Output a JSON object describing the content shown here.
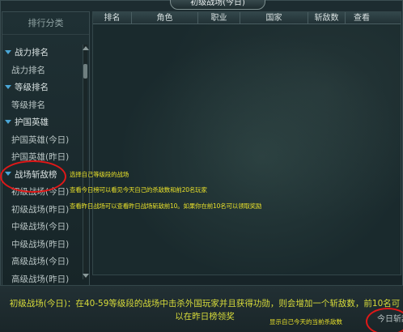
{
  "window": {
    "title": "初级战场(今日)"
  },
  "sidebar": {
    "header": "排行分类",
    "items": [
      {
        "label": "战力排名",
        "type": "category"
      },
      {
        "label": "战力排名",
        "type": "sub"
      },
      {
        "label": "等级排名",
        "type": "category"
      },
      {
        "label": "等级排名",
        "type": "sub"
      },
      {
        "label": "护国英雄",
        "type": "category"
      },
      {
        "label": "护国英雄(今日)",
        "type": "sub"
      },
      {
        "label": "护国英雄(昨日)",
        "type": "sub"
      },
      {
        "label": "战场斩敌榜",
        "type": "category"
      },
      {
        "label": "初级战场(今日)",
        "type": "sub"
      },
      {
        "label": "初级战场(昨日)",
        "type": "sub"
      },
      {
        "label": "中级战场(今日)",
        "type": "sub"
      },
      {
        "label": "中级战场(昨日)",
        "type": "sub"
      },
      {
        "label": "高级战场(今日)",
        "type": "sub"
      },
      {
        "label": "高级战场(昨日)",
        "type": "sub"
      }
    ]
  },
  "table": {
    "columns": [
      "排名",
      "角色",
      "职业",
      "国家",
      "斩敌数",
      "查看"
    ]
  },
  "annotations": {
    "tip1": "选择自己等级段的战场",
    "tip2": "查看今日榜可以看见今天自己的杀敌数和前20名玩家",
    "tip3": "查看昨日战场可以查看昨日战场斩敌前10。如果你在前10名可以领取奖励",
    "tip4": "显示自己今天的当前杀敌数"
  },
  "description": "初级战场(今日)：在40-59等级段的战场中击杀外国玩家并且获得功勋，则会增加一个斩敌数，前10名可以在昨日榜领奖",
  "corner_button": "今日斩敌",
  "colors": {
    "highlight_circle": "#e01818",
    "tip_text": "#e8e02a",
    "accent_triangle": "#4aa6d6"
  }
}
